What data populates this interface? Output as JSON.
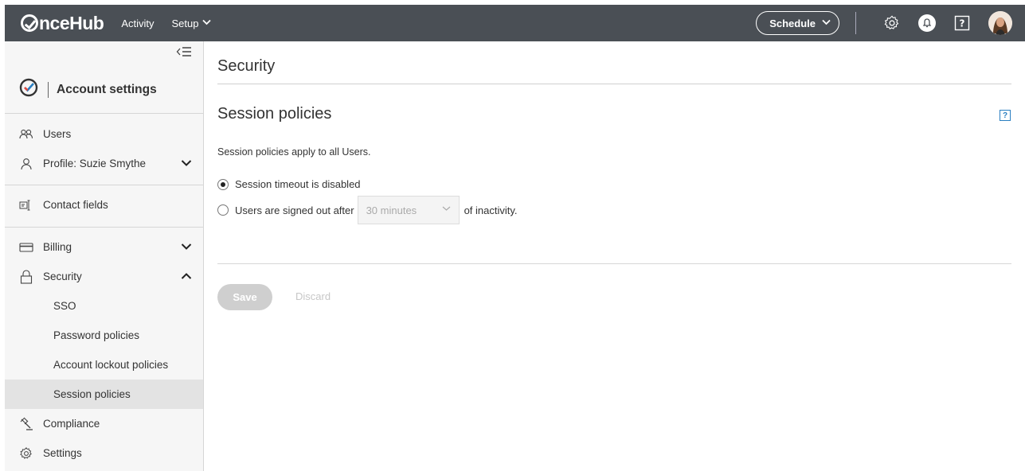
{
  "header": {
    "logo_text": "nceHub",
    "nav": [
      {
        "label": "Activity"
      },
      {
        "label": "Setup"
      }
    ],
    "schedule_label": "Schedule",
    "icons": [
      "gear-icon",
      "bell-icon",
      "help-icon",
      "avatar"
    ]
  },
  "sidebar": {
    "title": "Account settings",
    "items": {
      "users": "Users",
      "profile": "Profile: Suzie Smythe",
      "contact_fields": "Contact fields",
      "billing": "Billing",
      "security": "Security",
      "sso": "SSO",
      "password_policies": "Password policies",
      "account_lockout": "Account lockout policies",
      "session_policies": "Session policies",
      "compliance": "Compliance",
      "settings": "Settings"
    }
  },
  "main": {
    "page_title": "Security",
    "section_title": "Session policies",
    "description": "Session policies apply to all Users.",
    "option_disabled": "Session timeout is disabled",
    "option_signed_out_prefix": "Users are signed out after",
    "option_signed_out_suffix": "of inactivity.",
    "timeout_select_value": "30 minutes",
    "save_label": "Save",
    "discard_label": "Discard"
  },
  "colors": {
    "topbar": "#4a4f55",
    "active_item": "#e3e3e3",
    "help_blue": "#2a7fc1"
  }
}
